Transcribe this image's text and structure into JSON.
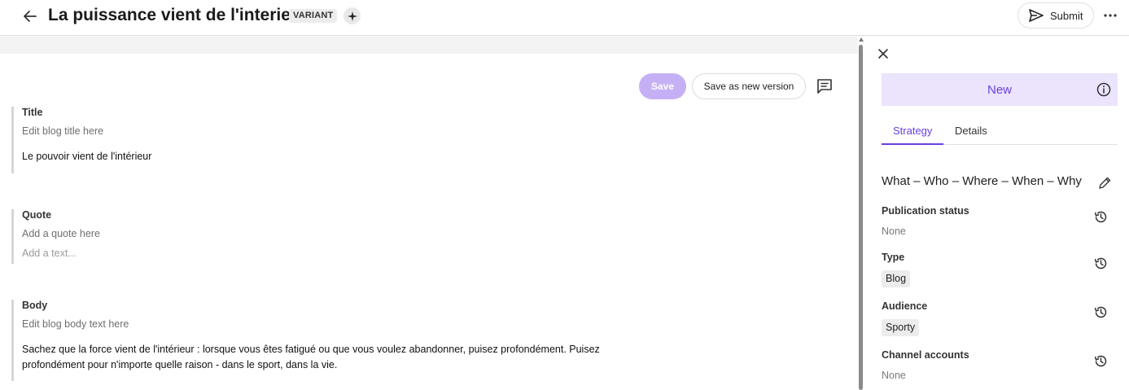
{
  "header": {
    "title": "La puissance vient de l'interieur",
    "badge": "VARIANT",
    "submit_label": "Submit",
    "icons": [
      "arrow-left-icon",
      "sparkle-icon",
      "send-icon",
      "more-horizontal-icon"
    ]
  },
  "editor": {
    "save_label": "Save",
    "save_version_label": "Save as new version",
    "fields": {
      "title": {
        "label": "Title",
        "hint": "Edit blog title here",
        "value": "Le pouvoir vient de l'intérieur"
      },
      "quote": {
        "label": "Quote",
        "hint": "Add a quote here",
        "placeholder": "Add a text..."
      },
      "body": {
        "label": "Body",
        "hint": "Edit blog body text here",
        "value_line1": "Sachez que la force vient de l'intérieur : lorsque vous êtes fatigué ou que vous voulez abandonner, puisez profondément. Puisez",
        "value_line2": "profondément pour n'importe quelle raison - dans le sport, dans la vie."
      }
    }
  },
  "panel": {
    "status": "New",
    "tabs": [
      {
        "label": "Strategy",
        "active": true
      },
      {
        "label": "Details",
        "active": false
      }
    ],
    "strategy_title": "What – Who – Where – When – Why",
    "properties": {
      "publication_status": {
        "label": "Publication status",
        "value": "None"
      },
      "type": {
        "label": "Type",
        "value": "Blog"
      },
      "audience": {
        "label": "Audience",
        "value": "Sporty"
      },
      "channel_accounts": {
        "label": "Channel accounts",
        "value": "None"
      }
    }
  },
  "colors": {
    "accent": "#6a3fe0",
    "save_disabled": "#c6b0f5",
    "status_bg": "#ece4fd"
  }
}
